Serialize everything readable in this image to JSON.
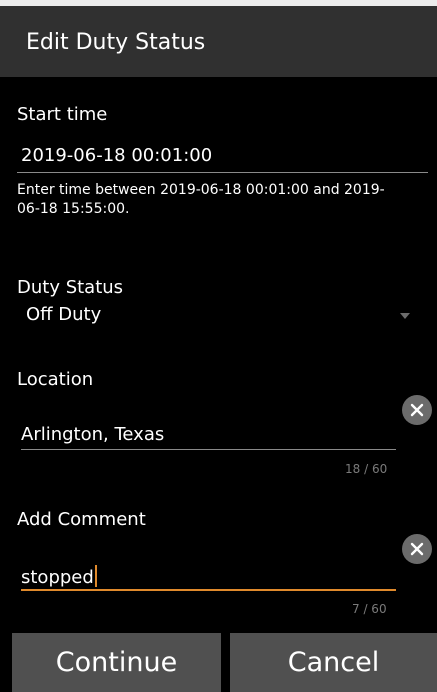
{
  "dialog": {
    "title": "Edit Duty Status"
  },
  "start_time": {
    "label": "Start time",
    "value": "2019-06-18 00:01:00",
    "hint": "Enter time between 2019-06-18 00:01:00 and 2019-06-18 15:55:00."
  },
  "duty_status": {
    "label": "Duty Status",
    "selected": "Off Duty",
    "arrow_icon": "dropdown-arrow-icon"
  },
  "location": {
    "label": "Location",
    "value": "Arlington, Texas",
    "counter": "18 / 60",
    "clear_icon": "close-icon"
  },
  "comment": {
    "label": "Add Comment",
    "value": "stopped",
    "counter": "7 / 60",
    "clear_icon": "close-icon"
  },
  "buttons": {
    "continue": "Continue",
    "cancel": "Cancel"
  },
  "colors": {
    "accent": "#e08a2c",
    "title_bar": "#303030",
    "button": "#505050",
    "background": "#000000"
  }
}
